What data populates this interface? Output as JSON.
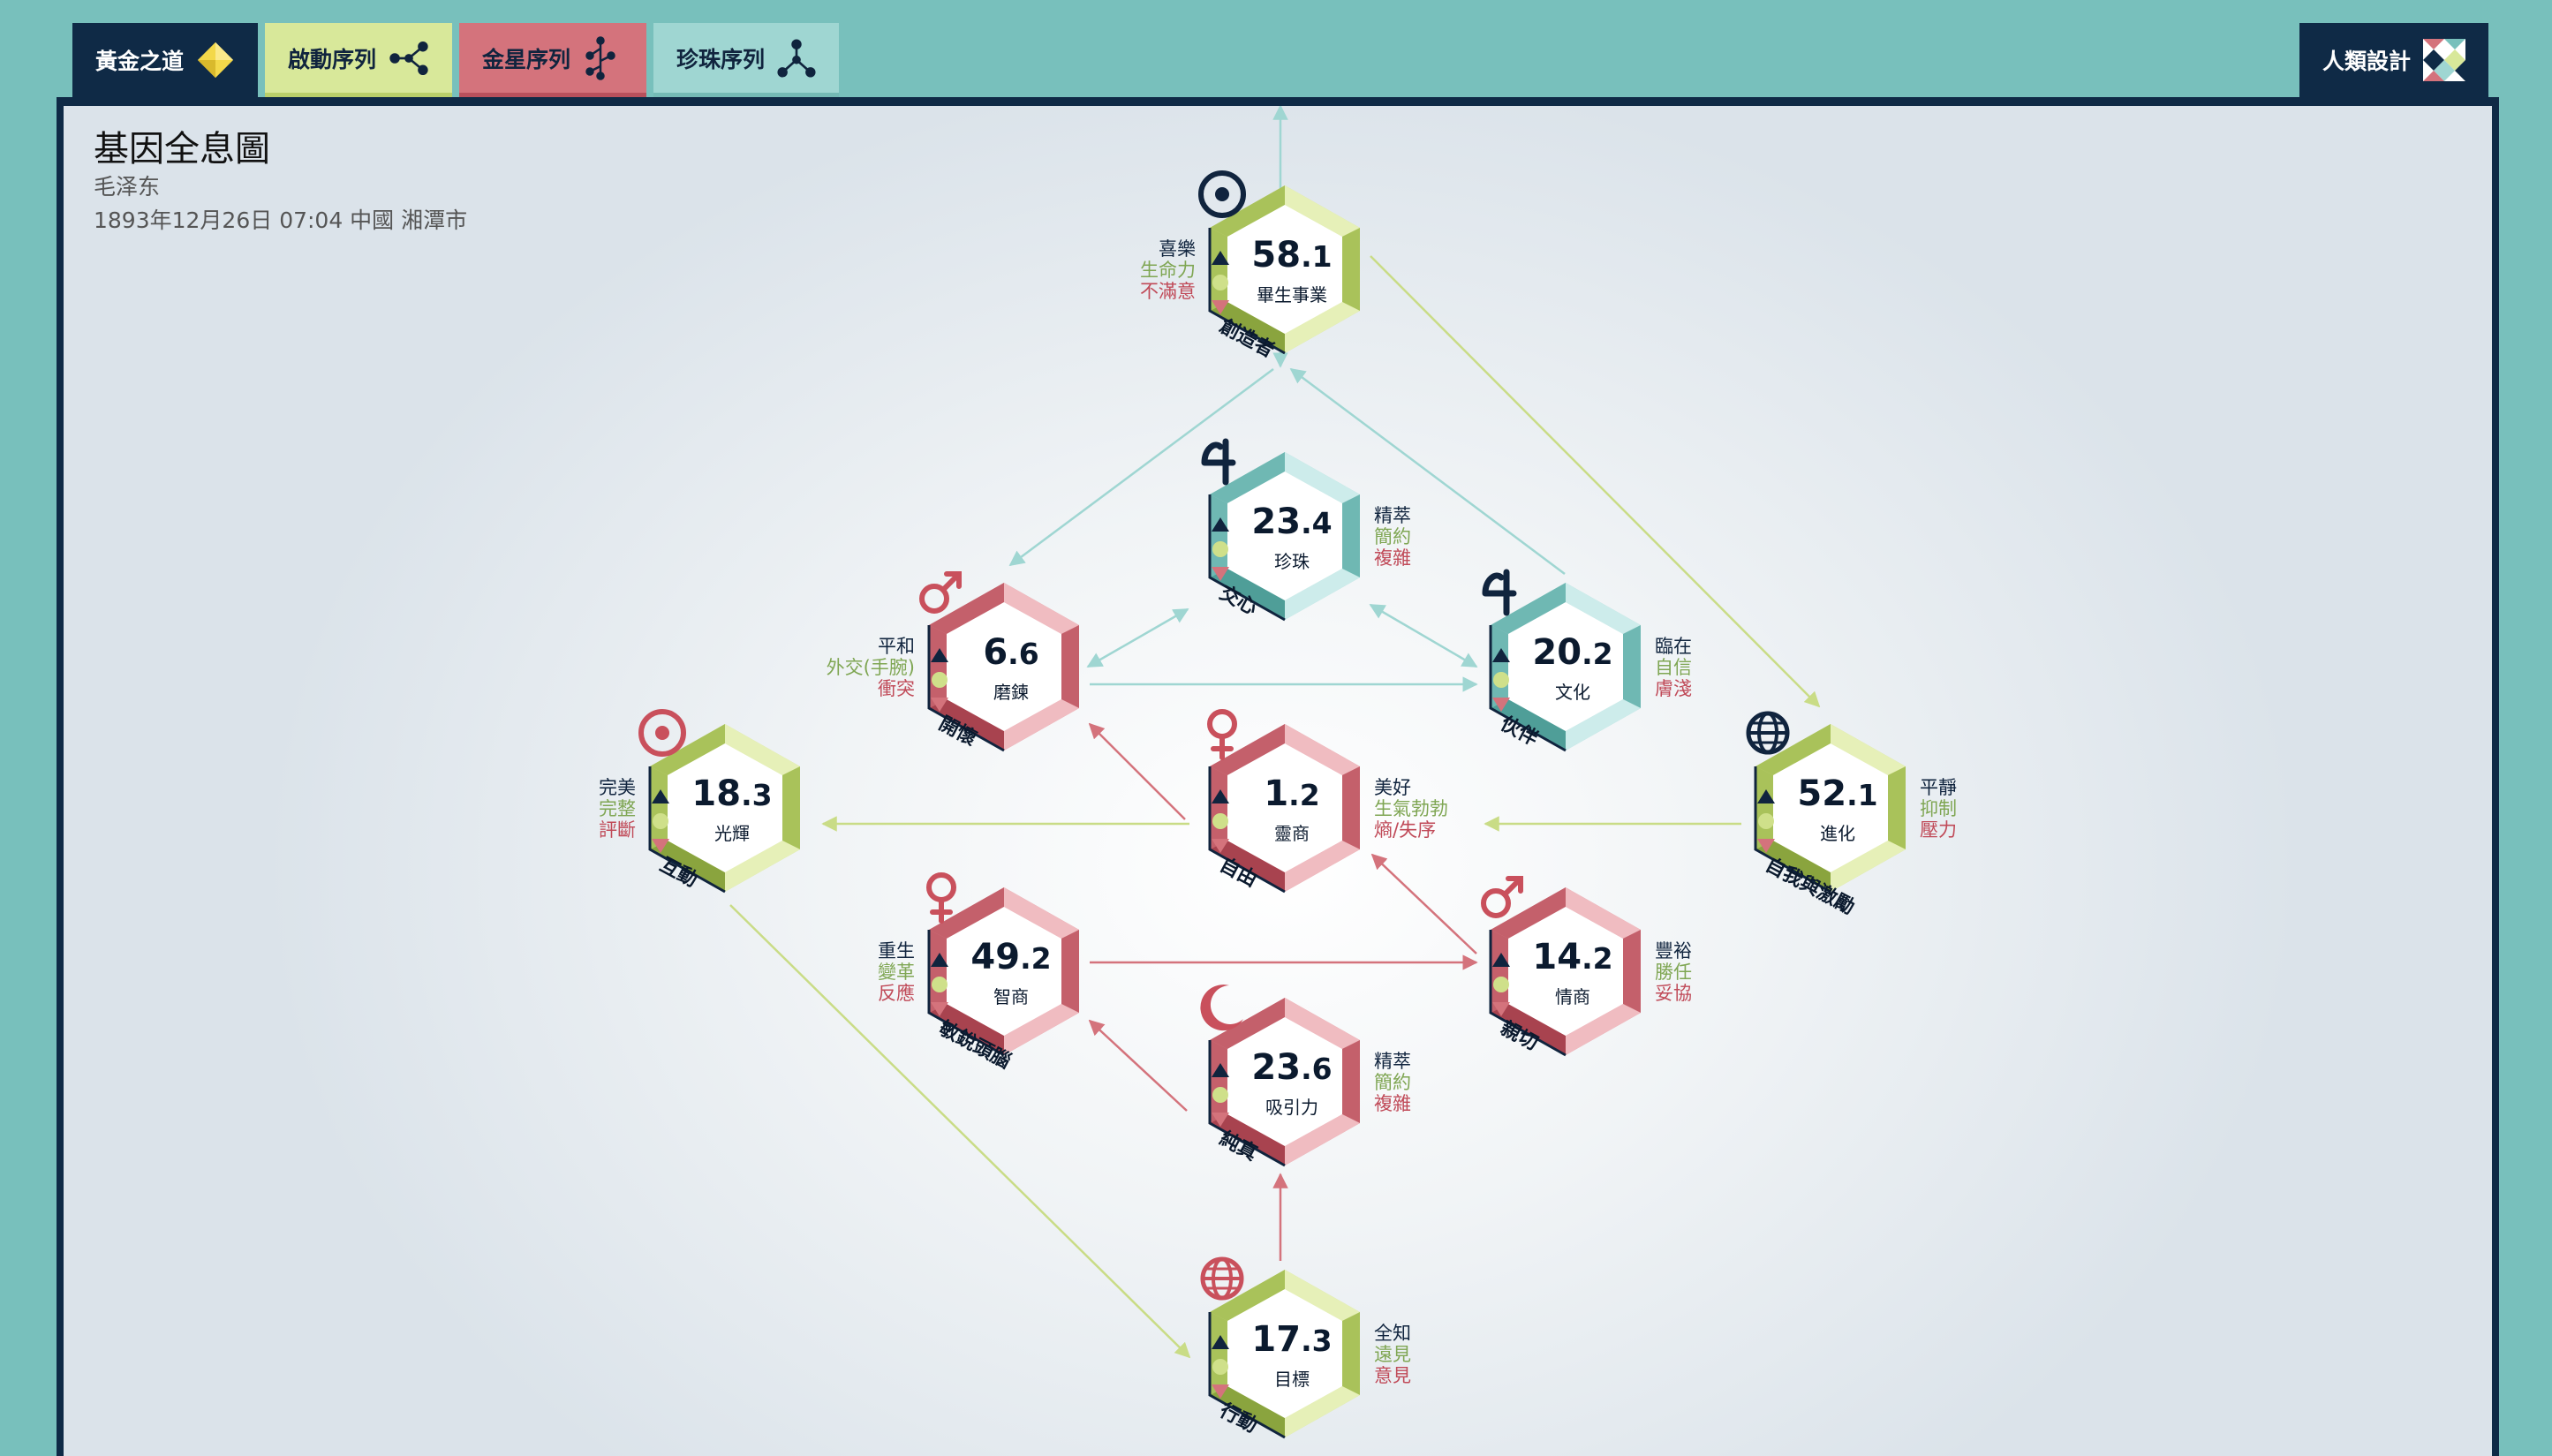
{
  "tabs": [
    {
      "label": "黃金之道",
      "icon": "diamond-icon"
    },
    {
      "label": "啟動序列",
      "icon": "activation-network-icon"
    },
    {
      "label": "金星序列",
      "icon": "venus-network-icon"
    },
    {
      "label": "珍珠序列",
      "icon": "pearl-network-icon"
    }
  ],
  "human_design": {
    "label": "人類設計",
    "icon": "human-design-logo-icon"
  },
  "header": {
    "title": "基因全息圖",
    "name": "毛泽东",
    "birth": "1893年12月26日 07:04 中國 湘潭市"
  },
  "colors": {
    "teal": "#78c0bc",
    "navy": "#0f2a46",
    "lime": "#d8e89a",
    "rose": "#d4737c",
    "aqua": "#9fd6d2"
  },
  "gates": [
    {
      "id": "calling",
      "int": "58",
      "dec": ".1",
      "name": "畢生事業",
      "archetype": "創造者",
      "planet": "sun-icon",
      "color": "lime",
      "keywords": [
        "喜樂",
        "生命力",
        "不滿意"
      ],
      "kw_side": "left"
    },
    {
      "id": "pearl",
      "int": "23",
      "dec": ".4",
      "name": "珍珠",
      "archetype": "交心",
      "planet": "jupiter-icon",
      "color": "aqua",
      "keywords": [
        "精萃",
        "簡約",
        "複雜"
      ],
      "kw_side": "right"
    },
    {
      "id": "practice",
      "int": "6",
      "dec": ".6",
      "name": "磨鍊",
      "archetype": "開懷",
      "planet": "mars-icon",
      "color": "rose",
      "keywords": [
        "平和",
        "外交(手腕)",
        "衝突"
      ],
      "kw_side": "left"
    },
    {
      "id": "culture",
      "int": "20",
      "dec": ".2",
      "name": "文化",
      "archetype": "伙伴",
      "planet": "jupiter-icon",
      "color": "aqua",
      "keywords": [
        "臨在",
        "自信",
        "膚淺"
      ],
      "kw_side": "right"
    },
    {
      "id": "radiance",
      "int": "18",
      "dec": ".3",
      "name": "光輝",
      "archetype": "互動",
      "planet": "target-icon",
      "color": "lime",
      "keywords": [
        "完美",
        "完整",
        "評斷"
      ],
      "kw_side": "left"
    },
    {
      "id": "sq",
      "int": "1",
      "dec": ".2",
      "name": "靈商",
      "archetype": "自由",
      "planet": "venus-icon",
      "color": "rose",
      "keywords": [
        "美好",
        "生氣勃勃",
        "熵/失序"
      ],
      "kw_side": "right"
    },
    {
      "id": "evolution",
      "int": "52",
      "dec": ".1",
      "name": "進化",
      "archetype": "自我與激勵",
      "planet": "globe-icon",
      "color": "lime",
      "keywords": [
        "平靜",
        "抑制",
        "壓力"
      ],
      "kw_side": "right"
    },
    {
      "id": "iq",
      "int": "49",
      "dec": ".2",
      "name": "智商",
      "archetype": "敏銳頭腦",
      "planet": "venus-icon",
      "color": "rose",
      "keywords": [
        "重生",
        "變革",
        "反應"
      ],
      "kw_side": "left"
    },
    {
      "id": "eq",
      "int": "14",
      "dec": ".2",
      "name": "情商",
      "archetype": "親切",
      "planet": "mars-icon",
      "color": "rose",
      "keywords": [
        "豐裕",
        "勝任",
        "妥協"
      ],
      "kw_side": "right"
    },
    {
      "id": "attraction",
      "int": "23",
      "dec": ".6",
      "name": "吸引力",
      "archetype": "純真",
      "planet": "moon-icon",
      "color": "rose",
      "keywords": [
        "精萃",
        "簡約",
        "複雜"
      ],
      "kw_side": "right"
    },
    {
      "id": "purpose",
      "int": "17",
      "dec": ".3",
      "name": "目標",
      "archetype": "行動",
      "planet": "globe-icon",
      "color": "lime",
      "keywords": [
        "全知",
        "遠見",
        "意見"
      ],
      "kw_side": "right"
    }
  ]
}
